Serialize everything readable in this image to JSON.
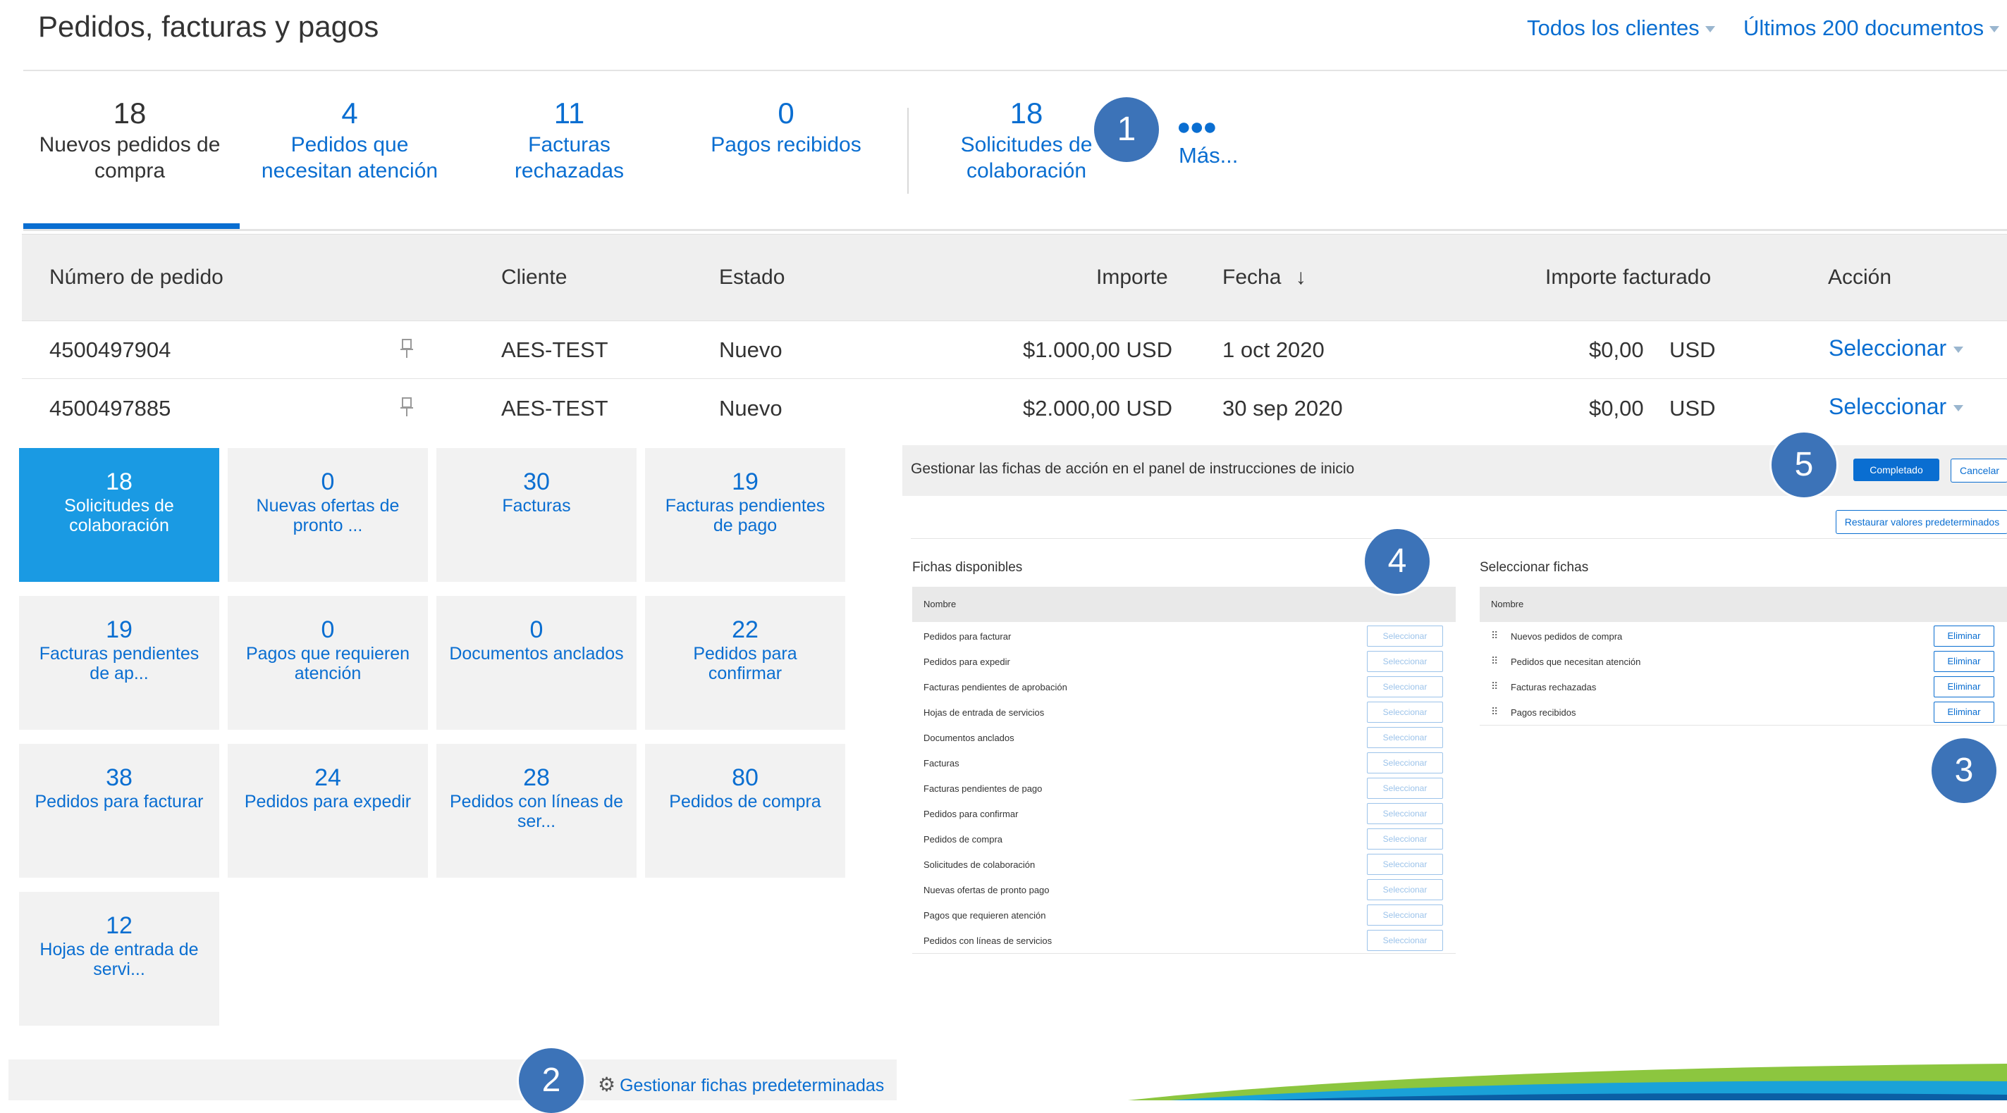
{
  "header": {
    "title": "Pedidos, facturas y pagos",
    "clients_filter": "Todos los clientes",
    "docs_filter": "Últimos 200 documentos"
  },
  "summary_tabs": [
    {
      "count": "18",
      "label": "Nuevos pedidos de compra",
      "active": true
    },
    {
      "count": "4",
      "label": "Pedidos que necesitan atención"
    },
    {
      "count": "11",
      "label": "Facturas rechazadas"
    },
    {
      "count": "0",
      "label": "Pagos recibidos"
    },
    {
      "count": "18",
      "label": "Solicitudes de colaboración"
    }
  ],
  "more": {
    "icon": "more-dots-icon",
    "label": "Más..."
  },
  "table": {
    "columns": [
      "Número de pedido",
      "Cliente",
      "Estado",
      "Importe",
      "Fecha",
      "Importe facturado",
      "Acción"
    ],
    "rows": [
      {
        "order": "4500497904",
        "client": "AES-TEST",
        "status": "Nuevo",
        "amount": "$1.000,00 USD",
        "date": "1 oct 2020",
        "invoiced": "$0,00",
        "currency": "USD",
        "action": "Seleccionar"
      },
      {
        "order": "4500497885",
        "client": "AES-TEST",
        "status": "Nuevo",
        "amount": "$2.000,00 USD",
        "date": "30 sep 2020",
        "invoiced": "$0,00",
        "currency": "USD",
        "action": "Seleccionar"
      }
    ]
  },
  "tiles": [
    {
      "count": "18",
      "label": "Solicitudes de colaboración",
      "selected": true
    },
    {
      "count": "0",
      "label": "Nuevas ofertas de pronto ..."
    },
    {
      "count": "30",
      "label": "Facturas"
    },
    {
      "count": "19",
      "label": "Facturas pendientes de pago"
    },
    {
      "count": "19",
      "label": "Facturas pendientes de ap..."
    },
    {
      "count": "0",
      "label": "Pagos que requieren atención"
    },
    {
      "count": "0",
      "label": "Documentos anclados"
    },
    {
      "count": "22",
      "label": "Pedidos para confirmar"
    },
    {
      "count": "38",
      "label": "Pedidos para facturar"
    },
    {
      "count": "24",
      "label": "Pedidos para expedir"
    },
    {
      "count": "28",
      "label": "Pedidos con líneas de ser..."
    },
    {
      "count": "80",
      "label": "Pedidos de compra"
    },
    {
      "count": "12",
      "label": "Hojas de entrada de servi..."
    }
  ],
  "manage_link": "Gestionar fichas predeterminadas",
  "panel": {
    "title": "Gestionar las fichas de acción en el panel de instrucciones de inicio",
    "done": "Completado",
    "cancel": "Cancelar",
    "restore": "Restaurar valores predeterminados",
    "available_title": "Fichas disponibles",
    "selected_title": "Seleccionar fichas",
    "name_header": "Nombre",
    "select_label": "Seleccionar",
    "remove_label": "Eliminar",
    "available": [
      "Pedidos para facturar",
      "Pedidos para expedir",
      "Facturas pendientes de aprobación",
      "Hojas de entrada de servicios",
      "Documentos anclados",
      "Facturas",
      "Facturas pendientes de pago",
      "Pedidos para confirmar",
      "Pedidos de compra",
      "Solicitudes de colaboración",
      "Nuevas ofertas de pronto pago",
      "Pagos que requieren atención",
      "Pedidos con líneas de servicios"
    ],
    "selected": [
      "Nuevos pedidos de compra",
      "Pedidos que necesitan atención",
      "Facturas rechazadas",
      "Pagos recibidos"
    ]
  },
  "callouts": [
    "1",
    "2",
    "3",
    "4",
    "5"
  ],
  "colors": {
    "accent": "#0a6ed1",
    "tile_selected": "#1a9ae3",
    "callout": "#3c73b8"
  }
}
